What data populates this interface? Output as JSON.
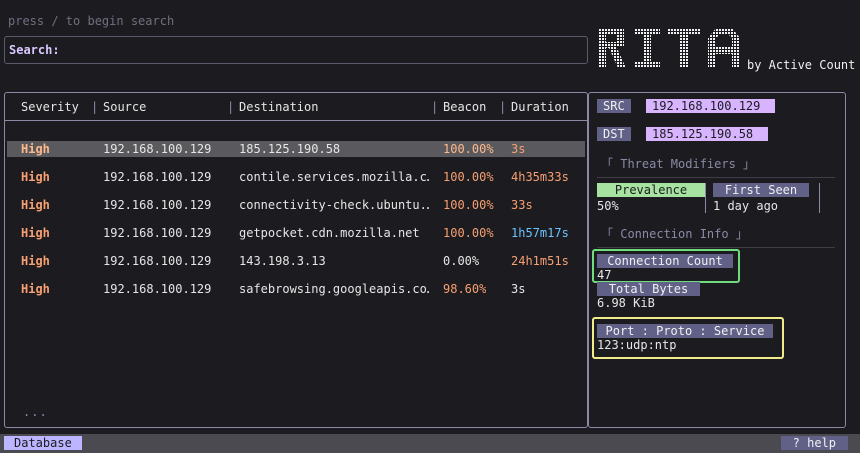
{
  "hint": "press / to begin search",
  "search": {
    "label": "Search:",
    "value": ""
  },
  "logo": {
    "text": "RITA",
    "byline": "by Active Count"
  },
  "table": {
    "headers": {
      "severity": "Severity",
      "source": "Source",
      "destination": "Destination",
      "beacon": "Beacon",
      "duration": "Duration"
    },
    "rows": [
      {
        "severity": "High",
        "source": "192.168.100.129",
        "destination": "185.125.190.58",
        "beacon": "100.00%",
        "duration": "3s",
        "selected": true
      },
      {
        "severity": "High",
        "source": "192.168.100.129",
        "destination": "contile.services.mozilla.c…",
        "beacon": "100.00%",
        "duration": "4h35m33s"
      },
      {
        "severity": "High",
        "source": "192.168.100.129",
        "destination": "connectivity-check.ubuntu.…",
        "beacon": "100.00%",
        "duration": "33s"
      },
      {
        "severity": "High",
        "source": "192.168.100.129",
        "destination": "getpocket.cdn.mozilla.net",
        "beacon": "100.00%",
        "duration": "1h57m17s"
      },
      {
        "severity": "High",
        "source": "192.168.100.129",
        "destination": "143.198.3.13",
        "beacon": "0.00%",
        "duration": "24h1m51s"
      },
      {
        "severity": "High",
        "source": "192.168.100.129",
        "destination": "safebrowsing.googleapis.co…",
        "beacon": "98.60%",
        "duration": "3s"
      }
    ],
    "more": "..."
  },
  "detail": {
    "src_label": "SRC",
    "src_value": "192.168.100.129",
    "dst_label": "DST",
    "dst_value": "185.125.190.58",
    "threat_modifiers_title": "「 Threat Modifiers 」",
    "prevalence_label": "Prevalence",
    "prevalence_value": "50%",
    "first_seen_label": "First Seen",
    "first_seen_value": "1 day ago",
    "connection_info_title": "「 Connection Info 」",
    "connection_count_label": "Connection Count",
    "connection_count_value": "47",
    "total_bytes_label": "Total Bytes",
    "total_bytes_value": "6.98 KiB",
    "port_label": "Port : Proto : Service",
    "port_value": "123:udp:ntp"
  },
  "status": {
    "database": "Database",
    "help": "? help"
  },
  "colors": {
    "accent": "#bcb5ff",
    "severity_high": "#f7a072",
    "duration_blue": "#6cc4ff",
    "highlight_green": "#6fdc7e",
    "highlight_yellow": "#f0ec8c"
  }
}
